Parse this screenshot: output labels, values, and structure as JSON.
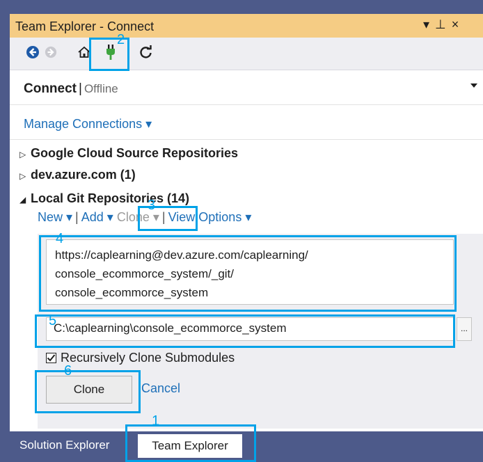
{
  "window": {
    "title": "Team Explorer - Connect",
    "controls": [
      "▾",
      "⊥",
      "×"
    ]
  },
  "toolbar": {
    "icons": [
      "back-arrow-icon",
      "forward-arrow-icon",
      "home-icon",
      "plug-connect-icon",
      "refresh-icon"
    ]
  },
  "connect": {
    "label": "Connect",
    "separator": "|",
    "status": "Offline"
  },
  "manage_connections": "Manage Connections ▾",
  "providers": [
    {
      "name": "Google Cloud Source Repositories",
      "expanded": false
    },
    {
      "name": "dev.azure.com (1)",
      "expanded": false
    },
    {
      "name": "Local Git Repositories (14)",
      "expanded": true
    }
  ],
  "local_actions": {
    "new": "New ▾",
    "add": "Add ▾",
    "clone": "Clone ▾",
    "view_options": "View Options ▾"
  },
  "clone_form": {
    "url_lines": [
      "https://caplearning@dev.azure.com/caplearning/",
      "console_ecommorce_system/_git/",
      "console_ecommorce_system"
    ],
    "path_value": "C:\\caplearning\\console_ecommorce_system",
    "browse_label": "...",
    "recursive_label": "Recursively Clone Submodules",
    "recursive_checked": true,
    "clone_button": "Clone",
    "cancel_link": "Cancel"
  },
  "bottom_tabs": {
    "solution_explorer": "Solution Explorer",
    "team_explorer": "Team Explorer"
  },
  "annotations": [
    "1",
    "2",
    "3",
    "4",
    "5",
    "6"
  ],
  "colors": {
    "title_bar": "#f5cc84",
    "link": "#1e6fb8",
    "highlight": "#00a2e8",
    "tab_bar": "#4d5a8a"
  }
}
